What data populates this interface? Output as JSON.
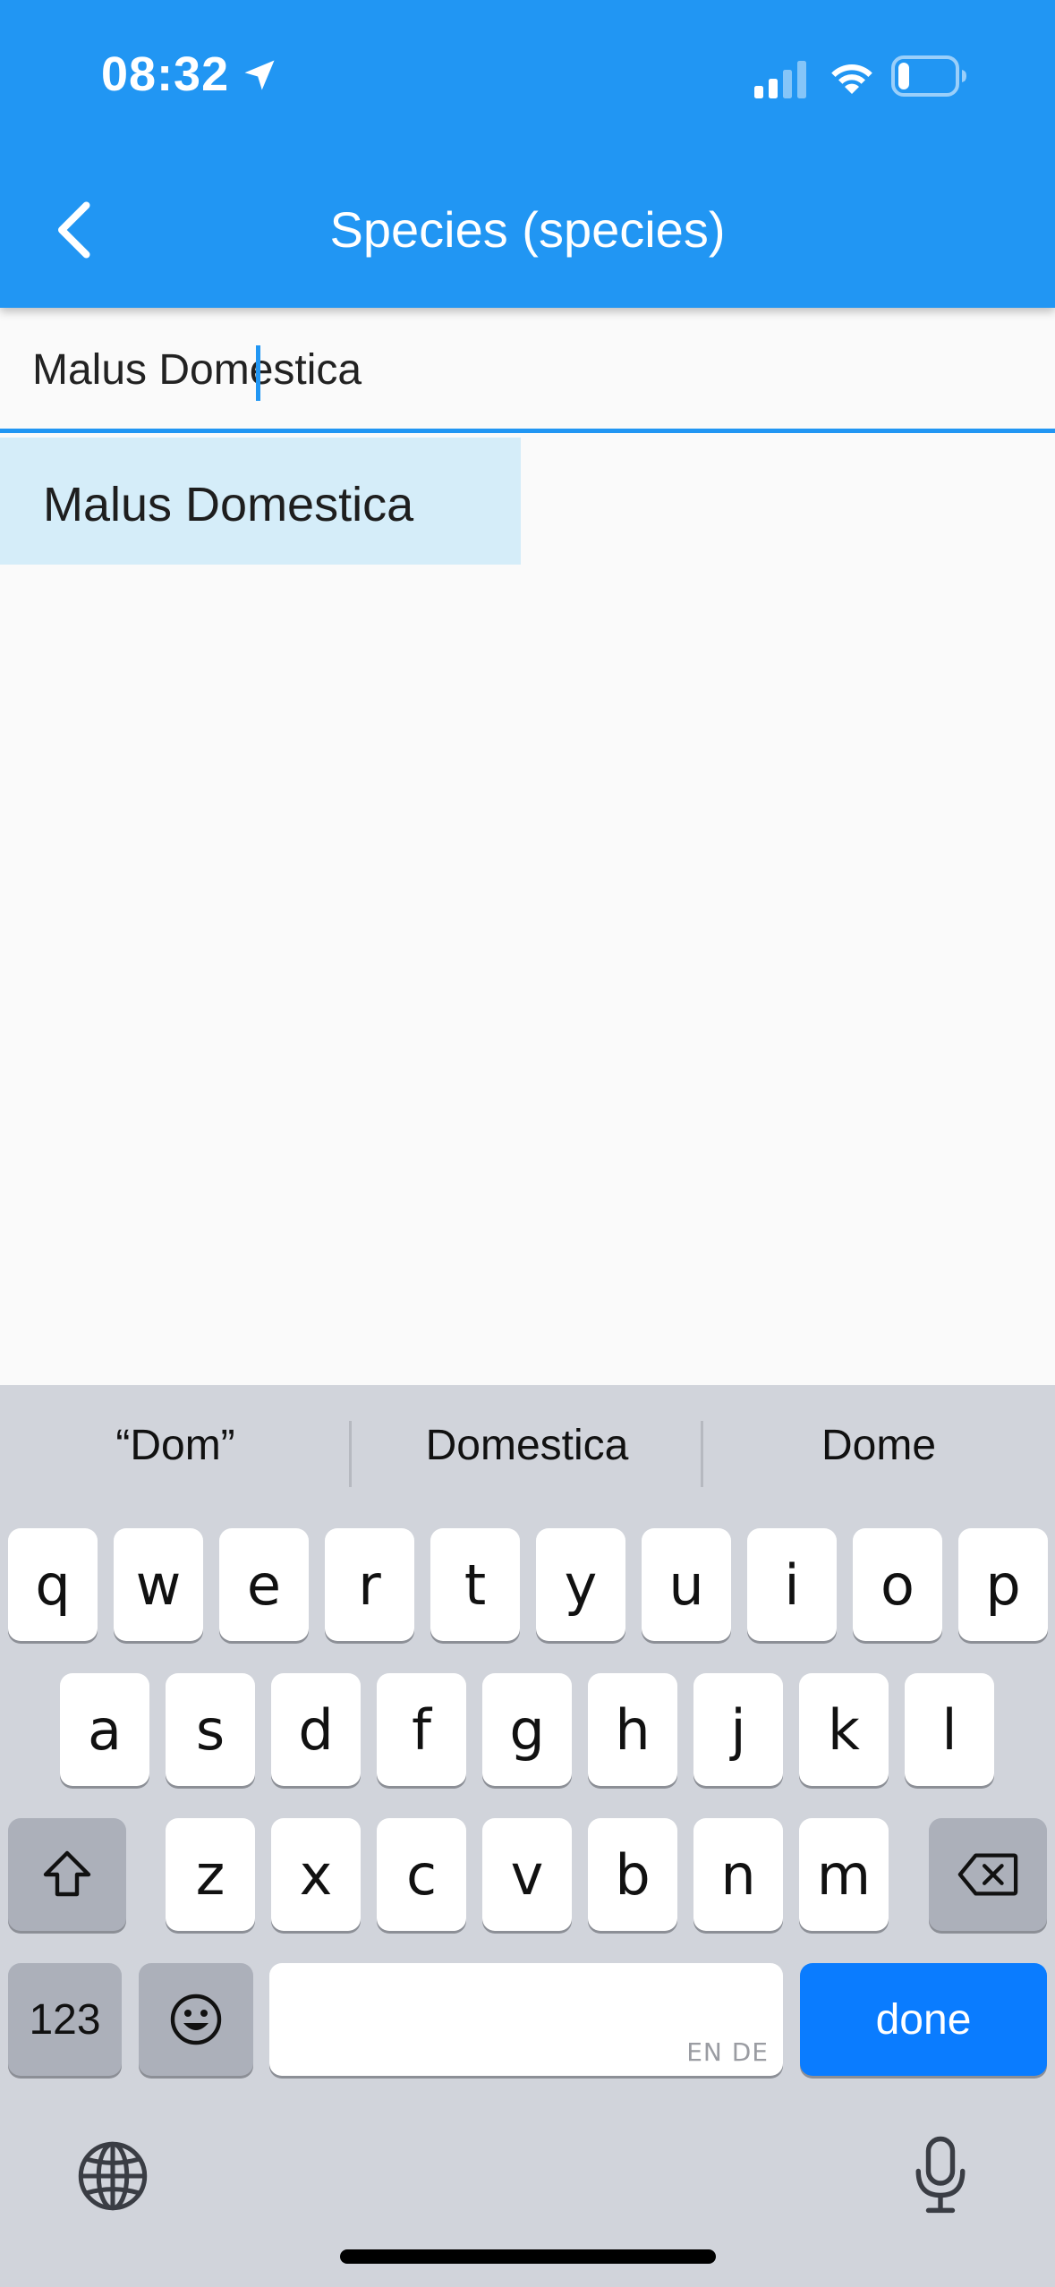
{
  "status_bar": {
    "time": "08:32",
    "icons": [
      "location-arrow-icon",
      "cellular-signal-icon",
      "wifi-icon",
      "battery-icon"
    ]
  },
  "app_bar": {
    "back_icon": "chevron-left-icon",
    "title": "Species (species)",
    "color": "#2196f3"
  },
  "search": {
    "value": "Malus Domestica",
    "caret_after": "Malus Dom"
  },
  "suggestions": [
    {
      "label": "Malus Domestica"
    }
  ],
  "keyboard": {
    "predictions": [
      "“Dom”",
      "Domestica",
      "Dome"
    ],
    "row1": [
      "q",
      "w",
      "e",
      "r",
      "t",
      "y",
      "u",
      "i",
      "o",
      "p"
    ],
    "row2": [
      "a",
      "s",
      "d",
      "f",
      "g",
      "h",
      "j",
      "k",
      "l"
    ],
    "row3": [
      "z",
      "x",
      "c",
      "v",
      "b",
      "n",
      "m"
    ],
    "numbers_label": "123",
    "space_languages": "EN DE",
    "done_label": "done",
    "done_color": "#0a7cff"
  }
}
